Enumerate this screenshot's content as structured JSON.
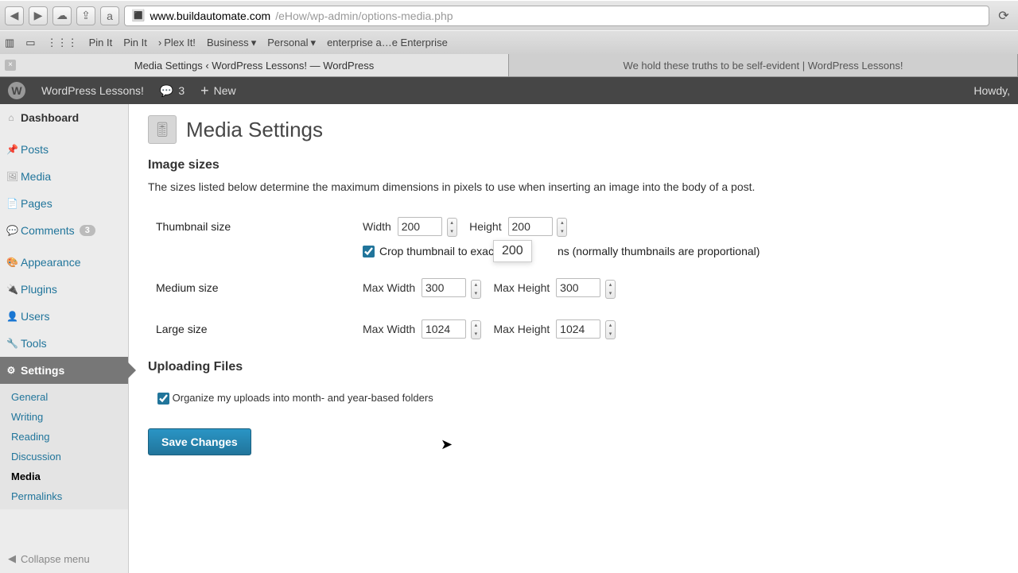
{
  "browser": {
    "url_host": "www.buildautomate.com",
    "url_path": "/eHow/wp-admin/options-media.php",
    "bookmarks": [
      "Pin It",
      "Pin It",
      "Plex It!",
      "Business",
      "Personal",
      "enterprise a…e Enterprise"
    ],
    "tabs": [
      "Media Settings ‹ WordPress Lessons! — WordPress",
      "We hold these truths to be self-evident | WordPress Lessons!"
    ]
  },
  "adminbar": {
    "site": "WordPress Lessons!",
    "comments": "3",
    "new": "New",
    "howdy": "Howdy, "
  },
  "sidebar": {
    "dashboard": "Dashboard",
    "posts": "Posts",
    "media": "Media",
    "pages": "Pages",
    "comments": "Comments",
    "comments_count": "3",
    "appearance": "Appearance",
    "plugins": "Plugins",
    "users": "Users",
    "tools": "Tools",
    "settings": "Settings",
    "submenu": {
      "general": "General",
      "writing": "Writing",
      "reading": "Reading",
      "discussion": "Discussion",
      "media": "Media",
      "permalinks": "Permalinks"
    },
    "collapse": "Collapse menu"
  },
  "page": {
    "title": "Media Settings",
    "section_sizes": "Image sizes",
    "desc": "The sizes listed below determine the maximum dimensions in pixels to use when inserting an image into the body of a post.",
    "thumb_label": "Thumbnail size",
    "width_label": "Width",
    "height_label": "Height",
    "thumb_w": "200",
    "thumb_h": "200",
    "crop_label_a": "Crop thumbnail to exac",
    "crop_label_b": "ns (normally thumbnails are proportional)",
    "tooltip_val": "200",
    "medium_label": "Medium size",
    "maxwidth_label": "Max Width",
    "maxheight_label": "Max Height",
    "medium_w": "300",
    "medium_h": "300",
    "large_label": "Large size",
    "large_w": "1024",
    "large_h": "1024",
    "section_upload": "Uploading Files",
    "organize_label": "Organize my uploads into month- and year-based folders",
    "save": "Save Changes"
  }
}
